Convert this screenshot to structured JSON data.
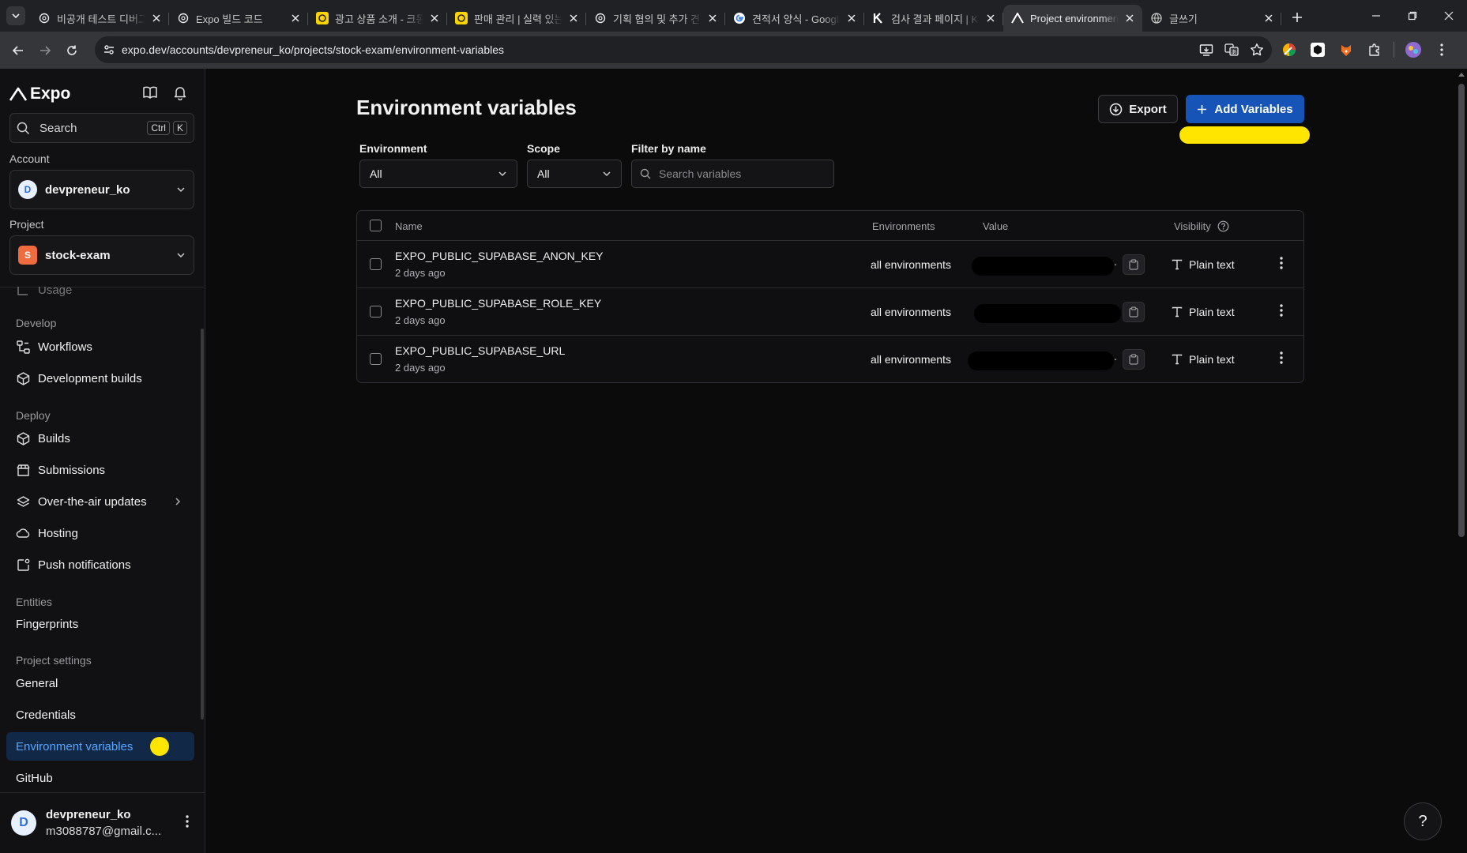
{
  "browser": {
    "tabs": [
      {
        "title": "비공개 테스트 디버그",
        "icon": "openai-icon"
      },
      {
        "title": "Expo 빌드 코드",
        "icon": "openai-icon"
      },
      {
        "title": "광고 상품 소개 - 크몽",
        "icon": "kmong-icon"
      },
      {
        "title": "판매 관리 | 실력 있는",
        "icon": "kmong-icon"
      },
      {
        "title": "기획 협의 및 추가 견적",
        "icon": "openai-icon"
      },
      {
        "title": "견적서 양식 - Google",
        "icon": "google-icon"
      },
      {
        "title": "검사 결과 페이지 | K",
        "icon": "k-icon"
      },
      {
        "title": "Project environment",
        "icon": "expo-icon"
      },
      {
        "title": "글쓰기",
        "icon": "globe-icon"
      }
    ],
    "url": "expo.dev/accounts/devpreneur_ko/projects/stock-exam/environment-variables"
  },
  "sidebar": {
    "brand": "Expo",
    "search": {
      "placeholder": "Search",
      "kbd1": "Ctrl",
      "kbd2": "K"
    },
    "account": {
      "label": "Account",
      "name": "devpreneur_ko",
      "initial": "D"
    },
    "project": {
      "label": "Project",
      "name": "stock-exam",
      "initial": "S"
    },
    "cut_item": "Usage",
    "groups": {
      "develop": "Develop",
      "deploy": "Deploy",
      "entities": "Entities",
      "settings": "Project settings"
    },
    "items": {
      "workflows": "Workflows",
      "dev_builds": "Development builds",
      "builds": "Builds",
      "submissions": "Submissions",
      "ota": "Over-the-air updates",
      "hosting": "Hosting",
      "push": "Push notifications",
      "fingerprints": "Fingerprints",
      "general": "General",
      "credentials": "Credentials",
      "env_vars": "Environment variables",
      "github": "GitHub"
    },
    "user": {
      "name": "devpreneur_ko",
      "email": "m3088787@gmail.c...",
      "initial": "D"
    }
  },
  "main": {
    "title": "Environment variables",
    "export_label": "Export",
    "add_label": "Add Variables",
    "filters": {
      "environment_label": "Environment",
      "environment_value": "All",
      "scope_label": "Scope",
      "scope_value": "All",
      "name_label": "Filter by name",
      "name_placeholder": "Search variables"
    },
    "table": {
      "headers": {
        "name": "Name",
        "environments": "Environments",
        "value": "Value",
        "visibility": "Visibility"
      },
      "rows": [
        {
          "name": "EXPO_PUBLIC_SUPABASE_ANON_KEY",
          "updated": "2 days ago",
          "environments": "all environments",
          "visibility": "Plain text",
          "value_suffix": "."
        },
        {
          "name": "EXPO_PUBLIC_SUPABASE_ROLE_KEY",
          "updated": "2 days ago",
          "environments": "all environments",
          "visibility": "Plain text",
          "value_suffix": ""
        },
        {
          "name": "EXPO_PUBLIC_SUPABASE_URL",
          "updated": "2 days ago",
          "environments": "all environments",
          "visibility": "Plain text",
          "value_suffix": "."
        }
      ]
    },
    "help": "?"
  },
  "colors": {
    "accent": "#1654b8",
    "active_nav_bg": "#122847",
    "active_nav_text": "#58a6ff",
    "highlight": "#ffe500",
    "background": "#0b0b0c"
  }
}
